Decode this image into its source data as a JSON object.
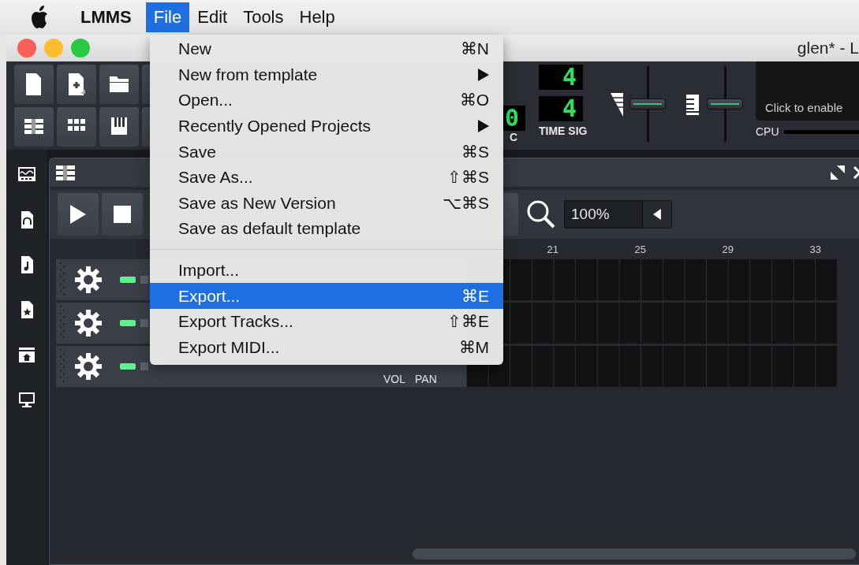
{
  "menubar": {
    "items": [
      {
        "label": "LMMS",
        "kind": "app",
        "selected": false
      },
      {
        "label": "File",
        "kind": "menu",
        "selected": true
      },
      {
        "label": "Edit",
        "kind": "menu",
        "selected": false
      },
      {
        "label": "Tools",
        "kind": "menu",
        "selected": false
      },
      {
        "label": "Help",
        "kind": "menu",
        "selected": false
      }
    ]
  },
  "window": {
    "title": "glen* - L"
  },
  "toolbar": {
    "tempo": {
      "value": "0",
      "label": "C"
    },
    "time_sig": {
      "numerator": "4",
      "denominator": "4",
      "label": "TIME SIG"
    },
    "master_volume": {
      "level": 0.5
    },
    "master_pitch": {
      "level": 0.5
    },
    "cpu": {
      "message": "Click to enable",
      "label": "CPU"
    }
  },
  "song_editor": {
    "zoom": "100%",
    "ruler": [
      "21",
      "25",
      "29",
      "33"
    ],
    "tracks": [
      {
        "active": true
      },
      {
        "active": true
      },
      {
        "active": true,
        "vol_label": "VOL",
        "pan_label": "PAN"
      }
    ]
  },
  "file_menu": {
    "items": [
      {
        "kind": "item",
        "label": "New",
        "shortcut": "⌘N",
        "submenu": false,
        "selected": false
      },
      {
        "kind": "item",
        "label": "New from template",
        "submenu": true,
        "selected": false
      },
      {
        "kind": "item",
        "label": "Open...",
        "shortcut": "⌘O",
        "submenu": false,
        "selected": false
      },
      {
        "kind": "item",
        "label": "Recently Opened Projects",
        "submenu": true,
        "selected": false
      },
      {
        "kind": "item",
        "label": "Save",
        "shortcut": "⌘S",
        "submenu": false,
        "selected": false
      },
      {
        "kind": "item",
        "label": "Save As...",
        "shortcut": "⇧⌘S",
        "submenu": false,
        "selected": false
      },
      {
        "kind": "item",
        "label": "Save as New Version",
        "shortcut": "⌥⌘S",
        "submenu": false,
        "selected": false
      },
      {
        "kind": "item",
        "label": "Save as default template",
        "submenu": false,
        "selected": false
      },
      {
        "kind": "separator"
      },
      {
        "kind": "item",
        "label": "Import...",
        "submenu": false,
        "selected": false
      },
      {
        "kind": "item",
        "label": "Export...",
        "shortcut": "⌘E",
        "submenu": false,
        "selected": true
      },
      {
        "kind": "item",
        "label": "Export Tracks...",
        "shortcut": "⇧⌘E",
        "submenu": false,
        "selected": false
      },
      {
        "kind": "item",
        "label": "Export MIDI...",
        "shortcut": "⌘M",
        "submenu": false,
        "selected": false
      }
    ]
  }
}
